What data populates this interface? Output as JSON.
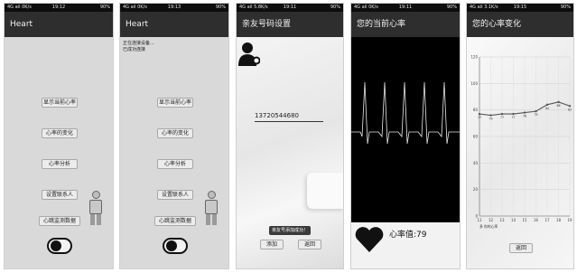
{
  "status_bars": [
    {
      "left": "4G ail 0K/s",
      "center": "19:12",
      "right": "90%"
    },
    {
      "left": "4G ail 0K/s",
      "center": "19:13",
      "right": "90%"
    },
    {
      "left": "4G ail 5.8K/s",
      "center": "19:11",
      "right": "90%"
    },
    {
      "left": "4G ail 0K/s",
      "center": "19:11",
      "right": "90%"
    },
    {
      "left": "4G ail 3.1K/s",
      "center": "19:15",
      "right": "90%"
    }
  ],
  "screen1": {
    "title": "Heart",
    "buttons": [
      "显示当前心率",
      "心率的变化",
      "心率分析",
      "设置联系人",
      "心跳监测数据"
    ]
  },
  "screen2": {
    "title": "Heart",
    "notice_line1": "正在连接设备...",
    "notice_line2": "已成功连接",
    "buttons": [
      "显示当前心率",
      "心率的变化",
      "心率分析",
      "设置联系人",
      "心跳监测数据"
    ]
  },
  "screen3": {
    "title": "亲友号码设置",
    "phone_value": "13720544680",
    "toast": "亲友号添加成功！",
    "add_label": "添加",
    "back_label": "返回"
  },
  "screen4": {
    "title": "您的当前心率",
    "heart_rate_label": "心率值:79"
  },
  "screen5": {
    "title": "您的心率变化",
    "back_label": "返回",
    "legend": "多 你的心率"
  },
  "chart_data": {
    "type": "line",
    "x": [
      11,
      12,
      13,
      14,
      15,
      16,
      17,
      18,
      19
    ],
    "values": [
      77,
      76,
      77,
      77,
      78,
      79,
      84,
      86,
      83
    ],
    "xticks": [
      "11",
      "12",
      "13",
      "14",
      "15",
      "16",
      "17",
      "18",
      "19"
    ],
    "yticks": [
      "120",
      "100",
      "80",
      "60",
      "40",
      "20",
      "0"
    ],
    "ylim": [
      0,
      120
    ],
    "colors": {
      "line": "#555555"
    }
  }
}
